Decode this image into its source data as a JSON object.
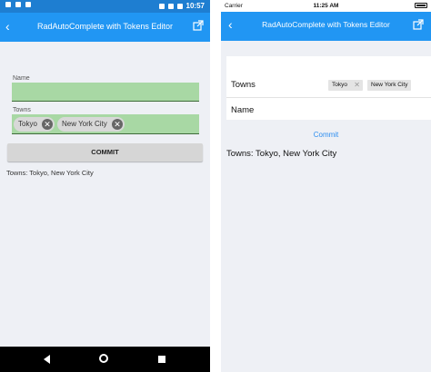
{
  "android": {
    "status_time": "10:57",
    "title": "RadAutoComplete with Tokens Editor",
    "name_label": "Name",
    "towns_label": "Towns",
    "tokens": [
      "Tokyo",
      "New York City"
    ],
    "commit_label": "COMMIT",
    "result_text": "Towns: Tokyo, New York City"
  },
  "ios": {
    "carrier": "Carrier",
    "status_time": "11:25 AM",
    "title": "RadAutoComplete with Tokens Editor",
    "towns_label": "Towns",
    "tokens": [
      "Tokyo",
      "New York City"
    ],
    "name_label": "Name",
    "commit_label": "Commit",
    "result_text": "Towns: Tokyo, New York City"
  },
  "colors": {
    "toolbar": "#2196f3",
    "status_bar": "#1e7ed1",
    "field_bg": "#a8d8a4",
    "ios_link": "#2d8ef0"
  },
  "icons": [
    "back-arrow-icon",
    "open-external-icon",
    "remove-token-icon",
    "nav-back-icon",
    "nav-home-icon",
    "nav-recents-icon"
  ]
}
